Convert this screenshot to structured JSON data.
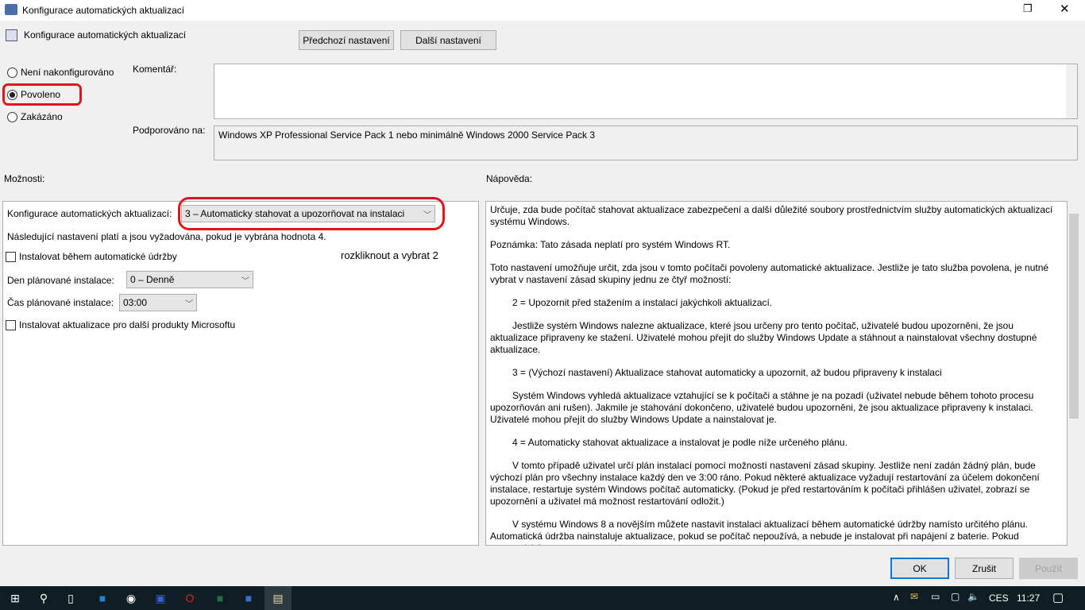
{
  "window": {
    "title": "Konfigurace automatických aktualizací",
    "maximize_icon": "restore-icon",
    "close_icon": "close-icon"
  },
  "header": {
    "policy_name": "Konfigurace automatických aktualizací",
    "prev_button": "Předchozí nastavení",
    "next_button": "Další nastavení"
  },
  "state": {
    "options": [
      "Není nakonfigurováno",
      "Povoleno",
      "Zakázáno"
    ],
    "selected": "Povoleno"
  },
  "comment": {
    "label": "Komentář:",
    "value": ""
  },
  "supported": {
    "label": "Podporováno na:",
    "value": "Windows XP Professional Service Pack 1 nebo minimálně Windows 2000 Service Pack 3"
  },
  "options": {
    "label": "Možnosti:",
    "config_label": "Konfigurace automatických aktualizací:",
    "config_value": "3 – Automaticky stahovat a upozorňovat na instalaci",
    "note": "Následující nastavení platí a jsou vyžadována, pokud je vybrána hodnota 4.",
    "maint_checkbox": "Instalovat během automatické údržby",
    "annotation": "rozkliknout a vybrat 2",
    "day_label": "Den plánované instalace:",
    "day_value": "0 – Denně",
    "time_label": "Čas plánované instalace:",
    "time_value": "03:00",
    "other_checkbox": "Instalovat aktualizace pro další produkty Microsoftu"
  },
  "help": {
    "label": "Nápověda:",
    "paragraphs": [
      "Určuje, zda bude počítač stahovat aktualizace zabezpečení a další důležité soubory prostřednictvím služby automatických aktualizací systému Windows.",
      "Poznámka: Tato zásada neplatí pro systém Windows RT.",
      "Toto nastavení umožňuje určit, zda jsou v tomto počítači povoleny automatické aktualizace. Jestliže je tato služba povolena, je nutné vybrat v nastavení zásad skupiny jednu ze čtyř možností:",
      "2 = Upozornit před stažením a instalací jakýchkoli aktualizací.",
      "Jestliže systém Windows nalezne aktualizace, které jsou určeny pro tento počítač, uživatelé budou upozorněni, že jsou aktualizace připraveny ke stažení. Uživatelé mohou přejít do služby Windows Update a stáhnout a nainstalovat všechny dostupné aktualizace.",
      "3 = (Výchozí nastavení) Aktualizace stahovat automaticky a upozornit, až budou připraveny k instalaci",
      "Systém Windows vyhledá aktualizace vztahující se k počítači a stáhne je na pozadí (uživatel nebude během tohoto procesu upozorňován ani rušen). Jakmile je stahování dokončeno, uživatelé budou upozorněni, že jsou aktualizace připraveny k instalaci. Uživatelé mohou přejít do služby Windows Update a nainstalovat je.",
      "4 = Automaticky stahovat aktualizace a instalovat je podle níže určeného plánu.",
      "V tomto případě uživatel určí plán instalací pomocí možností nastavení zásad skupiny. Jestliže není zadán žádný plán, bude výchozí plán pro všechny instalace každý den ve 3:00 ráno. Pokud některé aktualizace vyžadují restartování za účelem dokončení instalace, restartuje systém Windows počítač automaticky. (Pokud je před restartováním k počítači přihlášen uživatel, zobrazí se upozornění a uživatel má možnost restartování odložit.)",
      "V systému Windows 8 a novějším můžete nastavit instalaci aktualizací během automatické údržby namísto určitého plánu. Automatická údržba nainstaluje aktualizace, pokud se počítač nepoužívá, a nebude je instalovat při napájení z baterie. Pokud automatická"
    ]
  },
  "footer": {
    "ok": "OK",
    "cancel": "Zrušit",
    "apply": "Použít"
  },
  "taskbar": {
    "apps": [
      "start-icon",
      "search-icon",
      "task-view-icon",
      "outlook-icon",
      "app-icon",
      "save-icon",
      "opera-icon",
      "excel-icon",
      "powershell-icon",
      "notepad-icon"
    ],
    "language": "CES",
    "time": "11:27"
  },
  "colors": {
    "annotation": "#e0141e",
    "accent": "#0078d7"
  }
}
